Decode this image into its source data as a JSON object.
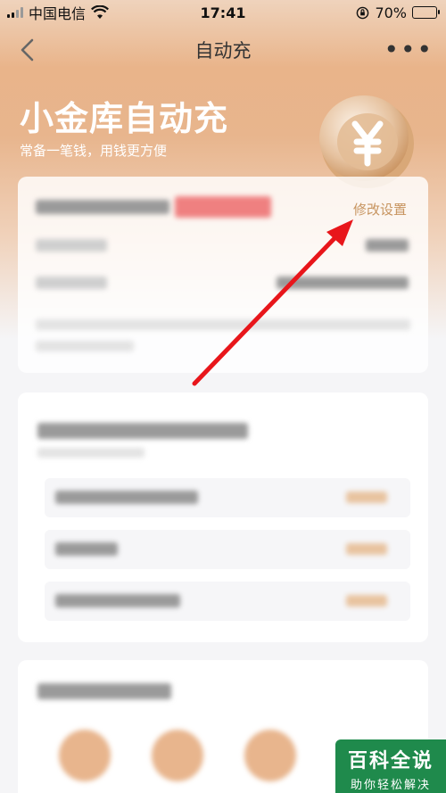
{
  "status": {
    "carrier": "中国电信",
    "time": "17:41",
    "battery": "70%"
  },
  "nav": {
    "title": "自动充",
    "back_icon": "chevron-left-icon",
    "more_icon": "more-dots-icon"
  },
  "hero": {
    "title": "小金库自动充",
    "subtitle": "常备一笔钱，用钱更方便",
    "coin_icon": "yuan-coin-icon"
  },
  "card": {
    "edit_label": "修改设置"
  },
  "watermark": {
    "title": "百科全说",
    "subtitle": "助你轻松解决"
  },
  "colors": {
    "accent": "#c7945f",
    "annotation_arrow": "#e8161b",
    "watermark_bg": "#1f8a4c"
  }
}
